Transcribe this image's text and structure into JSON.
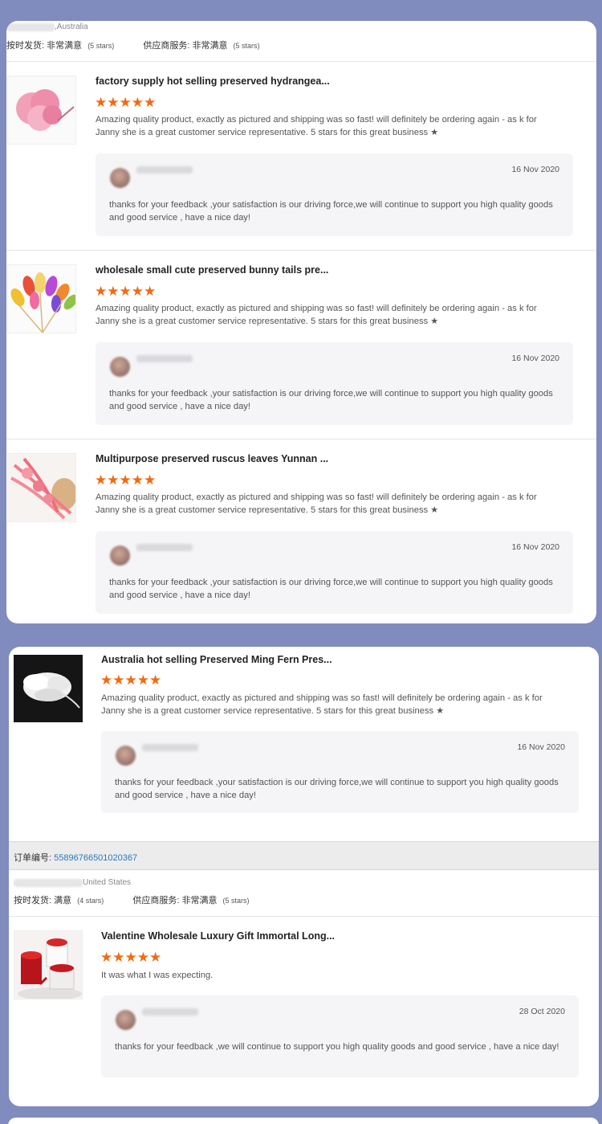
{
  "card1": {
    "buyer_country": ",Australia",
    "ratings": {
      "shipping_label": "按时发货:",
      "shipping_value": "非常满意",
      "shipping_stars": "(5 stars)",
      "supplier_label": "供应商服务:",
      "supplier_value": "非常满意",
      "supplier_stars": "(5 stars)"
    },
    "reviews": [
      {
        "title": "factory supply hot selling preserved hydrangea...",
        "stars": "★★★★★",
        "text": "Amazing quality product, exactly as pictured and shipping was so fast! will definitely be ordering again - as k for Janny she is a great customer service representative. 5 stars for this great business ★",
        "reply_date": "16 Nov 2020",
        "reply_text": "thanks for your feedback ,your satisfaction is our driving force,we will continue to support you high quality goods and good service , have a nice day!"
      },
      {
        "title": "wholesale small cute preserved bunny tails pre...",
        "stars": "★★★★★",
        "text": "Amazing quality product, exactly as pictured and shipping was so fast! will definitely be ordering again - as k for Janny she is a great customer service representative. 5 stars for this great business ★",
        "reply_date": "16 Nov 2020",
        "reply_text": "thanks for your feedback ,your satisfaction is our driving force,we will continue to support you high quality goods and good service , have a nice day!"
      },
      {
        "title": "Multipurpose preserved ruscus leaves Yunnan ...",
        "stars": "★★★★★",
        "text": "Amazing quality product, exactly as pictured and shipping was so fast! will definitely be ordering again - as k for Janny she is a great customer service representative. 5 stars for this great business ★",
        "reply_date": "16 Nov 2020",
        "reply_text": "thanks for your feedback ,your satisfaction is our driving force,we will continue to support you high quality goods and good service , have a nice day!"
      }
    ]
  },
  "card2": {
    "review": {
      "title": "Australia hot selling Preserved Ming Fern Pres...",
      "stars": "★★★★★",
      "text": "Amazing quality product, exactly as pictured and shipping was so fast! will definitely be ordering again - as k for Janny she is a great customer service representative. 5 stars for this great business ★",
      "reply_date": "16 Nov 2020",
      "reply_text": "thanks for your feedback ,your satisfaction is our driving force,we will continue to support you high quality goods and good service , have a nice day!"
    },
    "order_label": "订单编号:",
    "order_number": "55896766501020367",
    "buyer_country": "United States",
    "ratings": {
      "shipping_label": "按时发货:",
      "shipping_value": "满意",
      "shipping_stars": "(4 stars)",
      "supplier_label": "供应商服务:",
      "supplier_value": "非常满意",
      "supplier_stars": "(5 stars)"
    },
    "review2": {
      "title": "Valentine Wholesale Luxury Gift Immortal Long...",
      "stars": "★★★★★",
      "text": "It was what I was expecting.",
      "reply_date": "28 Oct 2020",
      "reply_text": "thanks for your feedback ,we will continue to support you high quality goods and good service , have a nice day!"
    }
  },
  "colors": {
    "background": "#7f8cbd",
    "star": "#f26a10",
    "order_number": "#2a78c2"
  }
}
